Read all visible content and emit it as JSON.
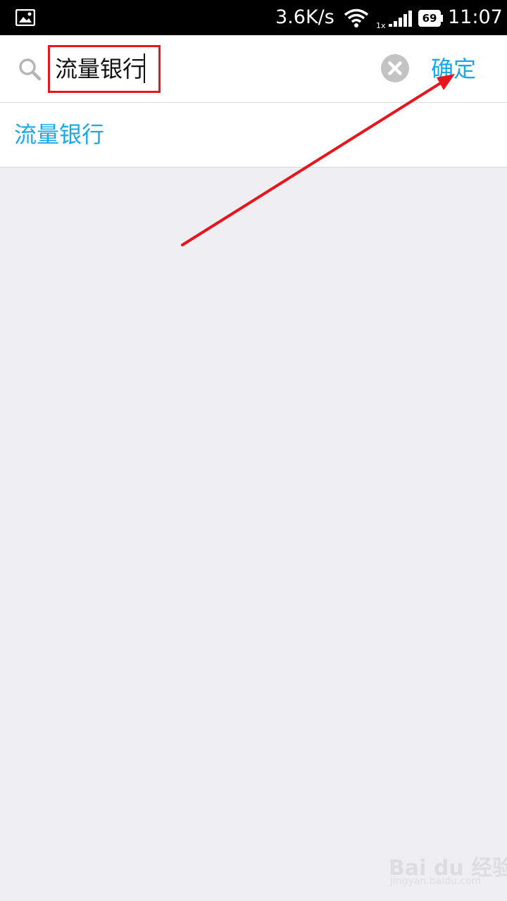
{
  "status_bar": {
    "network_speed": "3.6K/s",
    "signal_tag": "1x",
    "battery_level": "69",
    "time": "11:07",
    "icons": [
      "gallery-icon",
      "wifi-icon",
      "signal-icon",
      "battery-icon"
    ]
  },
  "search": {
    "value": "流量银行",
    "clear_icon": "close-circle-icon",
    "search_icon": "search-icon",
    "confirm_label": "确定"
  },
  "suggestions": [
    {
      "label": "流量银行"
    }
  ],
  "annotation": {
    "highlight_color": "#e8151d",
    "arrow_color": "#e8151d"
  },
  "colors": {
    "accent": "#1ba8e8",
    "background": "#efeef3",
    "status_bar": "#000000"
  },
  "watermark": {
    "main": "Bai du 经验",
    "sub": "jingyan.baidu.com"
  }
}
